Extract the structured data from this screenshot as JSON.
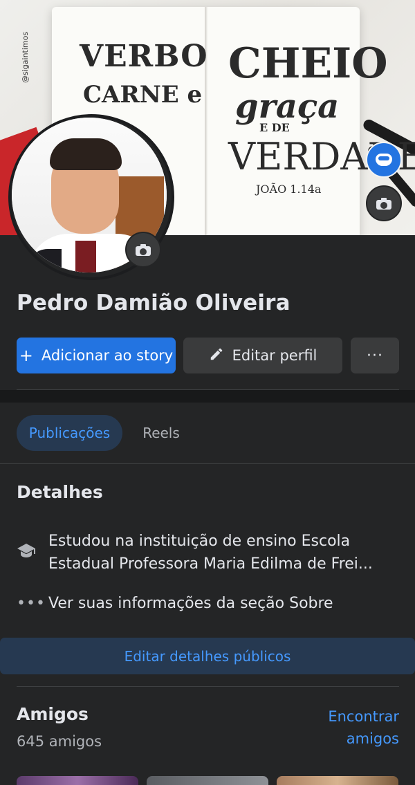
{
  "cover": {
    "lettering": [
      "VERBO",
      "CARNE e",
      "CHEIO",
      "graça",
      "E DE",
      "VERDADE",
      "JOÃO 1.14a"
    ],
    "side_tag": "@sigaintimos"
  },
  "profile": {
    "name": "Pedro Damião Oliveira"
  },
  "actions": {
    "add_story": "Adicionar ao story",
    "edit_profile": "Editar perfil",
    "more": "···"
  },
  "tabs": [
    {
      "label": "Publicações",
      "active": true
    },
    {
      "label": "Reels",
      "active": false
    }
  ],
  "details": {
    "title": "Detalhes",
    "items": [
      {
        "icon": "graduation-cap-icon",
        "text": "Estudou na instituição de ensino Escola Estadual Professora Maria Edilma de Frei..."
      },
      {
        "icon": "more-dots-icon",
        "text": "Ver suas informações da seção Sobre"
      }
    ],
    "edit_public": "Editar detalhes públicos"
  },
  "friends": {
    "title": "Amigos",
    "count": "645 amigos",
    "find": "Encontrar amigos"
  },
  "colors": {
    "background": "#242526",
    "primary": "#2374e1",
    "link": "#4599ff",
    "button": "#3a3b3c"
  }
}
